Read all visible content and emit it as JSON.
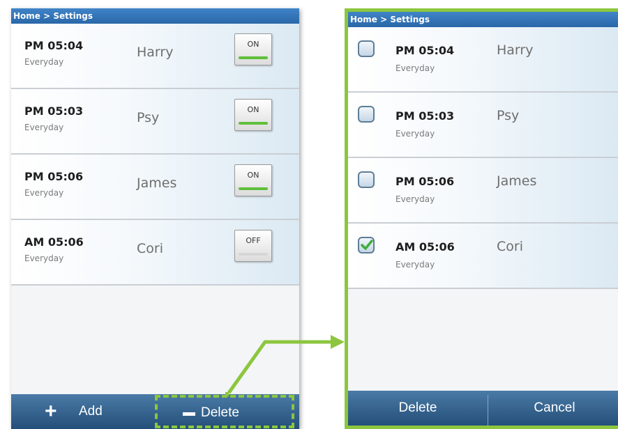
{
  "left": {
    "breadcrumb": "Home > Settings",
    "alarms": [
      {
        "time": "PM 05:04",
        "repeat": "Everyday",
        "name": "Harry",
        "toggle": "ON"
      },
      {
        "time": "PM 05:03",
        "repeat": "Everyday",
        "name": "Psy",
        "toggle": "ON"
      },
      {
        "time": "PM 05:06",
        "repeat": "Everyday",
        "name": "James",
        "toggle": "ON"
      },
      {
        "time": "AM 05:06",
        "repeat": "Everyday",
        "name": "Cori",
        "toggle": "OFF"
      }
    ],
    "bottom": {
      "add_label": "Add",
      "delete_label": "Delete"
    }
  },
  "right": {
    "breadcrumb": "Home > Settings",
    "alarms": [
      {
        "time": "PM 05:04",
        "repeat": "Everyday",
        "name": "Harry",
        "checked": false
      },
      {
        "time": "PM 05:03",
        "repeat": "Everyday",
        "name": "Psy",
        "checked": false
      },
      {
        "time": "PM 05:06",
        "repeat": "Everyday",
        "name": "James",
        "checked": false
      },
      {
        "time": "AM 05:06",
        "repeat": "Everyday",
        "name": "Cori",
        "checked": true
      }
    ],
    "bottom": {
      "delete_label": "Delete",
      "cancel_label": "Cancel"
    }
  },
  "colors": {
    "highlight": "#8cc63f",
    "header": "#2f6fb0",
    "toggle_on": "#5fbf3a"
  },
  "icons": {
    "add": "plus-icon",
    "delete": "minus-icon",
    "check": "checkmark-icon"
  }
}
